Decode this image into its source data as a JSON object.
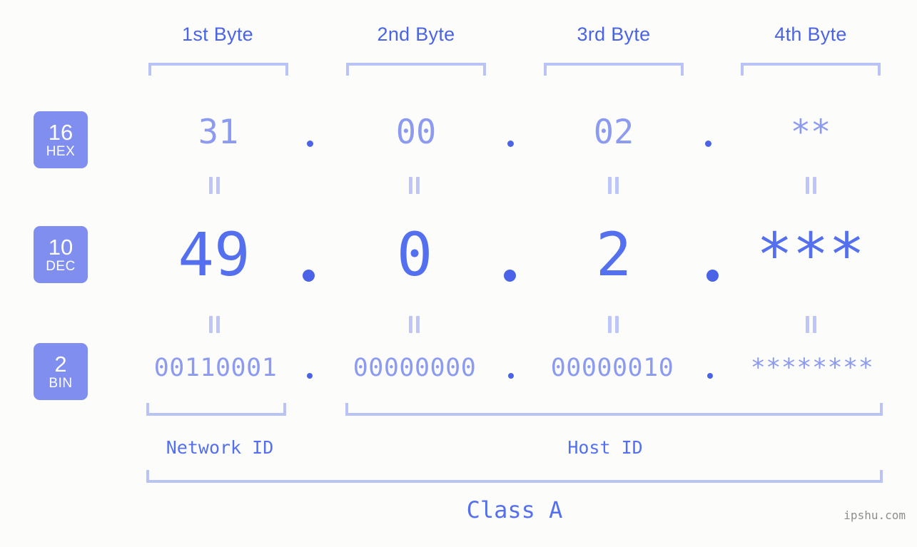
{
  "headers": [
    {
      "label": "1st Byte"
    },
    {
      "label": "2nd Byte"
    },
    {
      "label": "3rd Byte"
    },
    {
      "label": "4th Byte"
    }
  ],
  "badges": [
    {
      "number": "16",
      "name": "HEX"
    },
    {
      "number": "10",
      "name": "DEC"
    },
    {
      "number": "2",
      "name": "BIN"
    }
  ],
  "rows": {
    "hex": {
      "bytes": [
        "31",
        "00",
        "02",
        "**"
      ]
    },
    "dec": {
      "bytes": [
        "49",
        "0",
        "2",
        "***"
      ]
    },
    "bin": {
      "bytes": [
        "00110001",
        "00000000",
        "00000010",
        "********"
      ]
    }
  },
  "separators": {
    "dot": "."
  },
  "equals_mark": "=",
  "segments": {
    "network_id": "Network ID",
    "host_id": "Host ID"
  },
  "class_label": "Class A",
  "watermark": "ipshu.com",
  "colors": {
    "background": "#fcfdfa",
    "accent_strong": "#5570ee",
    "accent_light": "#8c9bf0",
    "bracket": "#b9c3f6",
    "badge_bg": "#7f8eef",
    "badge_text": "#ffffff",
    "dot": "#4a63e7",
    "watermark": "#8d8d8d"
  }
}
